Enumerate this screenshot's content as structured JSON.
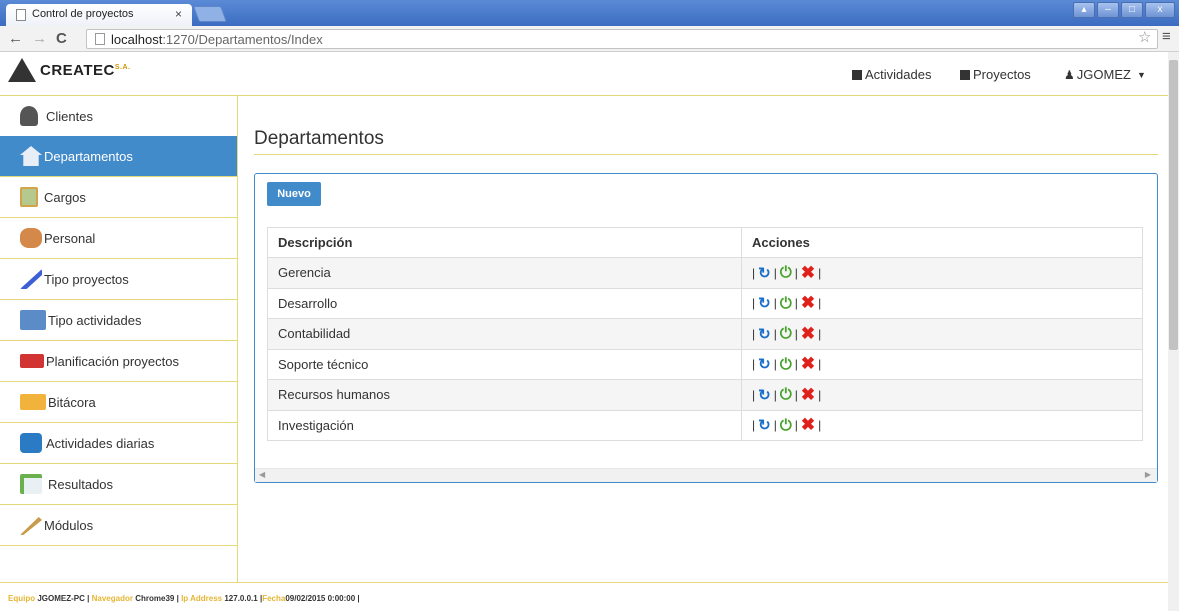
{
  "browser": {
    "tab_title": "Control de proyectos",
    "tab_close": "×",
    "url_host": "localhost",
    "url_path": ":1270/Departamentos/Index",
    "window_controls": [
      "▴",
      "–",
      "□",
      "x"
    ]
  },
  "header": {
    "logo_text": "CREATEC",
    "logo_suffix": "S.A.",
    "nav": {
      "actividades": "Actividades",
      "proyectos": "Proyectos",
      "user": "JGOMEZ"
    }
  },
  "sidebar": {
    "items": [
      {
        "label": "Clientes",
        "icon": "client-icon",
        "color": "#555555"
      },
      {
        "label": "Departamentos",
        "icon": "home-icon",
        "color": "#e8eef7",
        "active": true
      },
      {
        "label": "Cargos",
        "icon": "clipboard-icon",
        "color": "#b5c98f"
      },
      {
        "label": "Personal",
        "icon": "people-icon",
        "color": "#d4884a"
      },
      {
        "label": "Tipo proyectos",
        "icon": "pen-chart-icon",
        "color": "#3d5fd6"
      },
      {
        "label": "Tipo actividades",
        "icon": "folder-blue-icon",
        "color": "#5b8cc7"
      },
      {
        "label": "Planificación proyectos",
        "icon": "calendar-red-icon",
        "color": "#d23333"
      },
      {
        "label": "Bitácora",
        "icon": "folder-icon",
        "color": "#f2b33d"
      },
      {
        "label": "Actividades diarias",
        "icon": "group-chat-icon",
        "color": "#2a7bc4"
      },
      {
        "label": "Resultados",
        "icon": "spreadsheet-icon",
        "color": "#6ab04c"
      },
      {
        "label": "Módulos",
        "icon": "pencil-icon",
        "color": "#c89a4b"
      }
    ]
  },
  "main": {
    "title": "Departamentos",
    "new_button": "Nuevo",
    "columns": [
      "Descripción",
      "Acciones"
    ],
    "rows": [
      {
        "descripcion": "Gerencia"
      },
      {
        "descripcion": "Desarrollo"
      },
      {
        "descripcion": "Contabilidad"
      },
      {
        "descripcion": "Soporte técnico"
      },
      {
        "descripcion": "Recursos humanos"
      },
      {
        "descripcion": "Investigación"
      }
    ],
    "action_separator": "|"
  },
  "footer": {
    "equipo_label": "Equipo",
    "equipo_value": "JGOMEZ-PC",
    "navegador_label": "Navegador",
    "navegador_value": "Chrome39",
    "ip_label": "Ip Address",
    "ip_value": "127.0.0.1",
    "fecha_label": "Fecha",
    "fecha_value": "09/02/2015 0:00:00",
    "sep": "|"
  },
  "colors": {
    "primary": "#428bca",
    "accent_rule": "#e7d87a",
    "footer_label": "#e5b634"
  }
}
